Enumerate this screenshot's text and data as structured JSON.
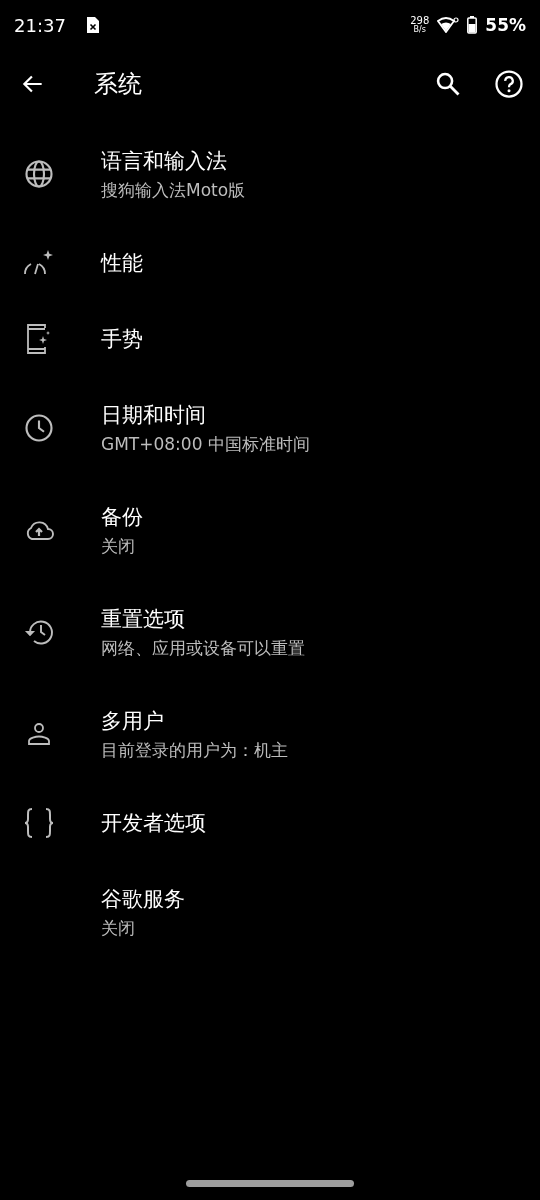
{
  "status_bar": {
    "time": "21:37",
    "net_speed": "298",
    "net_unit": "B/s",
    "battery": "55%"
  },
  "app_bar": {
    "title": "系统"
  },
  "items": [
    {
      "kind": "globe",
      "title": "语言和输入法",
      "summary": " 搜狗输入法Moto版"
    },
    {
      "kind": "gauge",
      "title": "性能"
    },
    {
      "kind": "phone",
      "title": "手势"
    },
    {
      "kind": "clock",
      "title": "日期和时间",
      "summary": "GMT+08:00 中国标准时间"
    },
    {
      "kind": "cloud",
      "title": "备份",
      "summary": "关闭"
    },
    {
      "kind": "history",
      "title": "重置选项",
      "summary": "网络、应用或设备可以重置"
    },
    {
      "kind": "person",
      "title": "多用户",
      "summary": "目前登录的用户为：机主"
    },
    {
      "kind": "braces",
      "title": "开发者选项"
    },
    {
      "kind": "plain",
      "title": "谷歌服务",
      "summary": "关闭"
    }
  ]
}
